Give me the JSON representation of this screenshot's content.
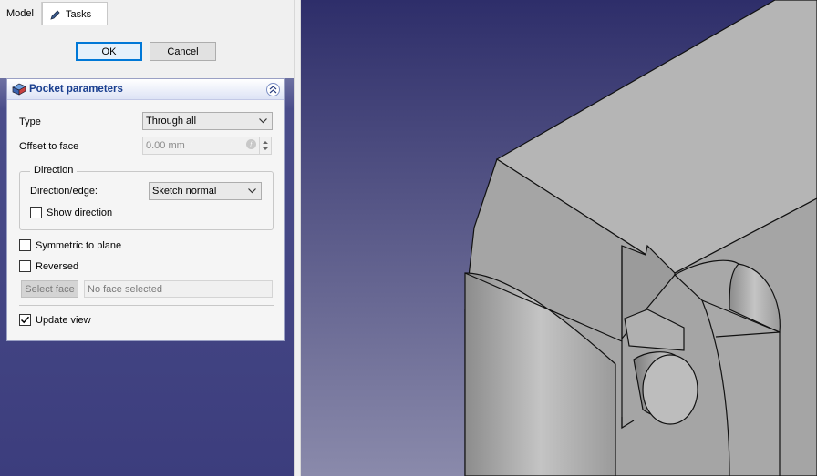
{
  "tabs": [
    {
      "label": "Model"
    },
    {
      "label": "Tasks"
    }
  ],
  "buttons": {
    "ok": "OK",
    "cancel": "Cancel"
  },
  "pocket": {
    "title": "Pocket parameters",
    "type_label": "Type",
    "type_value": "Through all",
    "offset_label": "Offset to face",
    "offset_value": "0.00 mm",
    "direction_title": "Direction",
    "direction_edge_label": "Direction/edge:",
    "direction_edge_value": "Sketch normal",
    "show_direction": {
      "label": "Show direction",
      "checked": false
    },
    "symmetric": {
      "label": "Symmetric to plane",
      "checked": false
    },
    "reversed": {
      "label": "Reversed",
      "checked": false
    },
    "select_face_label": "Select face",
    "face_field_value": "No face selected",
    "update_view": {
      "label": "Update view",
      "checked": true
    }
  },
  "colors": {
    "accent": "#0078d7",
    "header_title": "#1a3f8f",
    "viewport_bg_top": "#2e2e6a",
    "viewport_bg_bottom": "#8a8aab",
    "model_face": "#a9a9a9"
  },
  "icons": [
    "pencil-icon",
    "pocket-feature-icon",
    "collapse-icon",
    "chevron-down-icon",
    "expression-icon",
    "spin-icon",
    "checkmark-icon"
  ]
}
